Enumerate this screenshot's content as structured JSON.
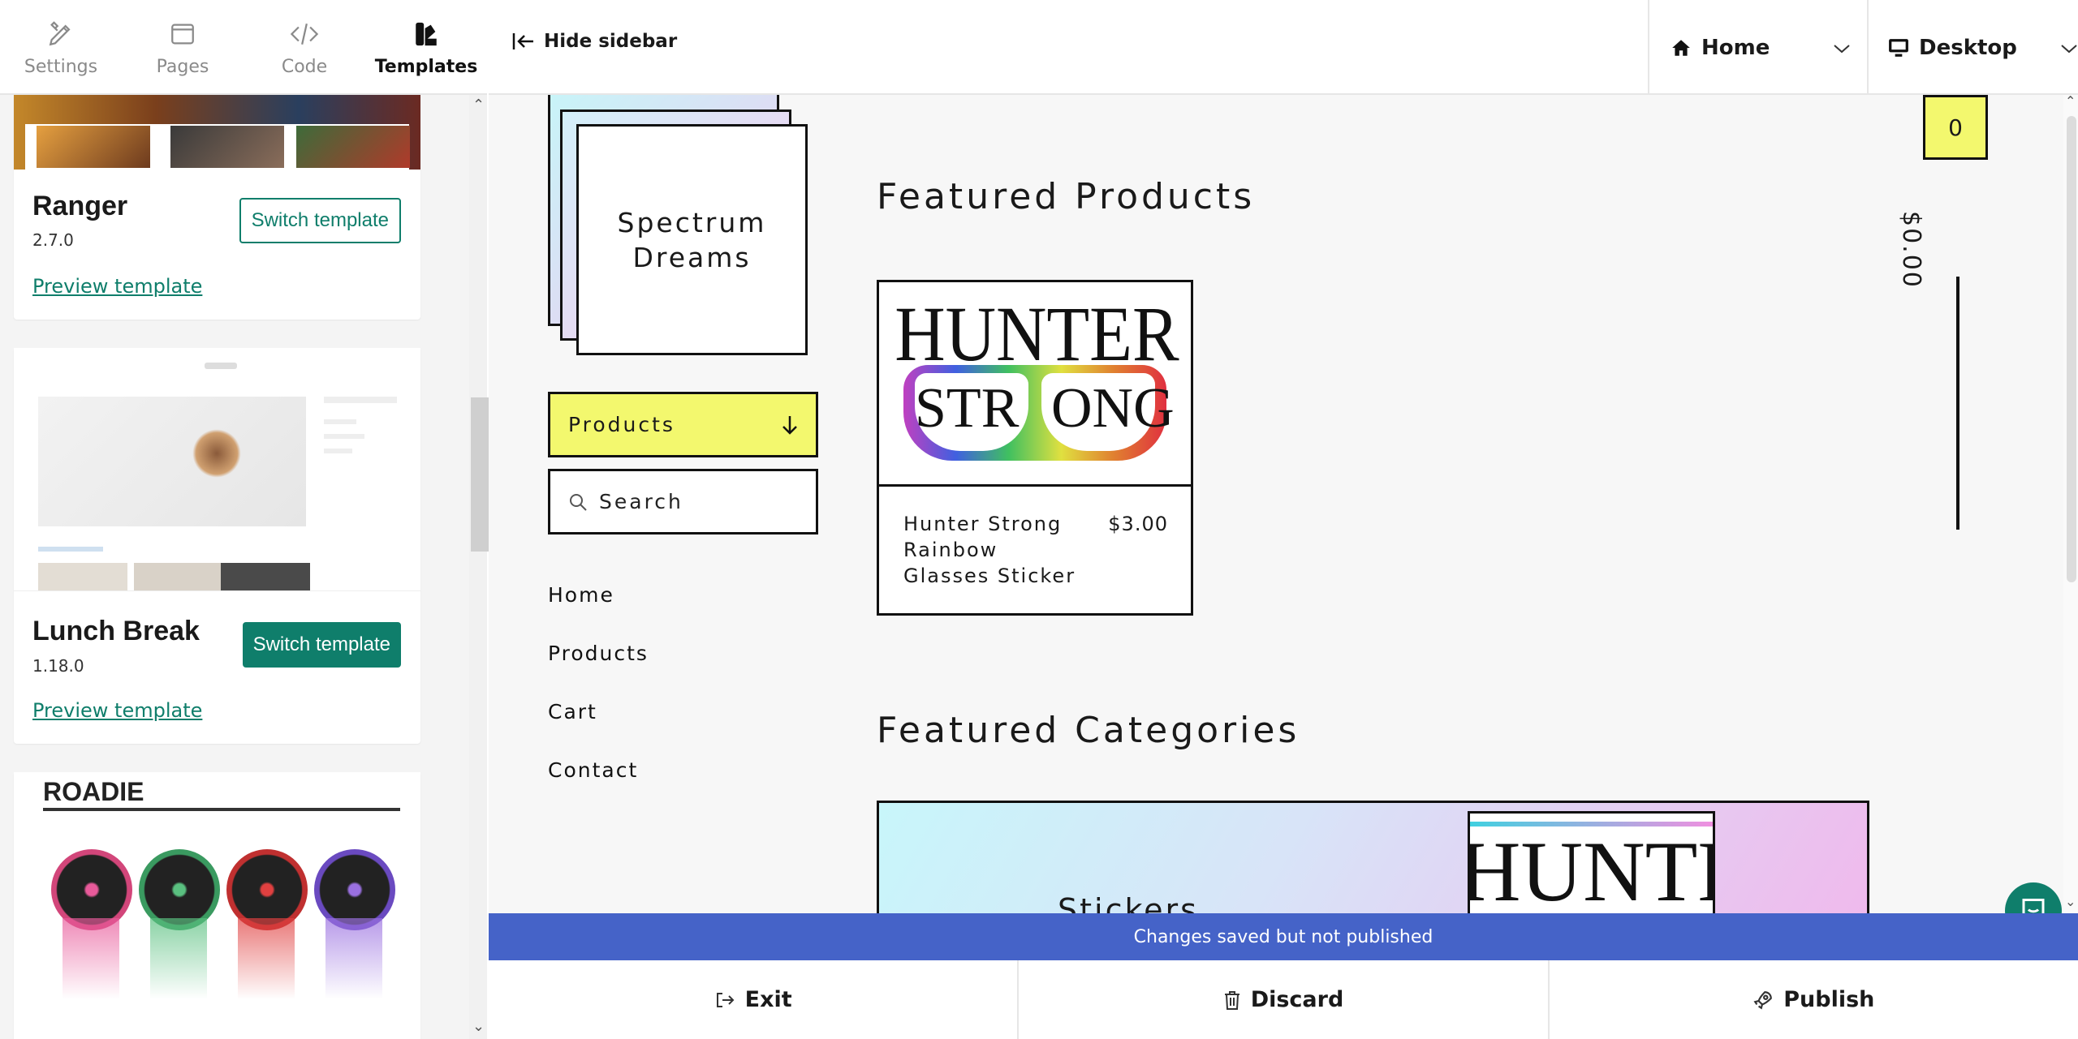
{
  "sidebar": {
    "tabs": [
      {
        "label": "Settings",
        "icon": "pencil-ruler-icon"
      },
      {
        "label": "Pages",
        "icon": "window-icon"
      },
      {
        "label": "Code",
        "icon": "code-icon"
      },
      {
        "label": "Templates",
        "icon": "paint-swatch-icon",
        "active": true
      }
    ],
    "templates": [
      {
        "name": "Ranger",
        "version": "2.7.0",
        "switch_label": "Switch template",
        "preview_label": "Preview template"
      },
      {
        "name": "Lunch Break",
        "version": "1.18.0",
        "switch_label": "Switch template",
        "preview_label": "Preview template"
      },
      {
        "name": "",
        "thumb_text": "ROADIE"
      }
    ]
  },
  "topbar": {
    "hide_sidebar_label": "Hide sidebar",
    "page_select": "Home",
    "device_select": "Desktop"
  },
  "store": {
    "logo_text_line1": "Spectrum",
    "logo_text_line2": "Dreams",
    "products_dropdown": "Products",
    "search_placeholder": "Search",
    "menu": [
      "Home",
      "Products",
      "Cart",
      "Contact"
    ],
    "featured_products_title": "Featured Products",
    "featured_categories_title": "Featured Categories",
    "product": {
      "image_text_top": "HUNTER",
      "image_text_bottom_left": "STR",
      "image_text_bottom_right": "ONG",
      "name_line1": "Hunter Strong",
      "name_line2": "Rainbow",
      "name_line3": "Glasses Sticker",
      "price": "$3.00"
    },
    "category": {
      "label": "Stickers",
      "image_text": "HUNTE"
    },
    "cart_count": "0",
    "cart_total": "$0.00"
  },
  "status": {
    "message": "Changes saved but not published",
    "color": "#4563c8"
  },
  "actions": {
    "exit": "Exit",
    "discard": "Discard",
    "publish": "Publish"
  },
  "colors": {
    "accent": "#0f7e6b",
    "yellow": "#f3f86e"
  }
}
